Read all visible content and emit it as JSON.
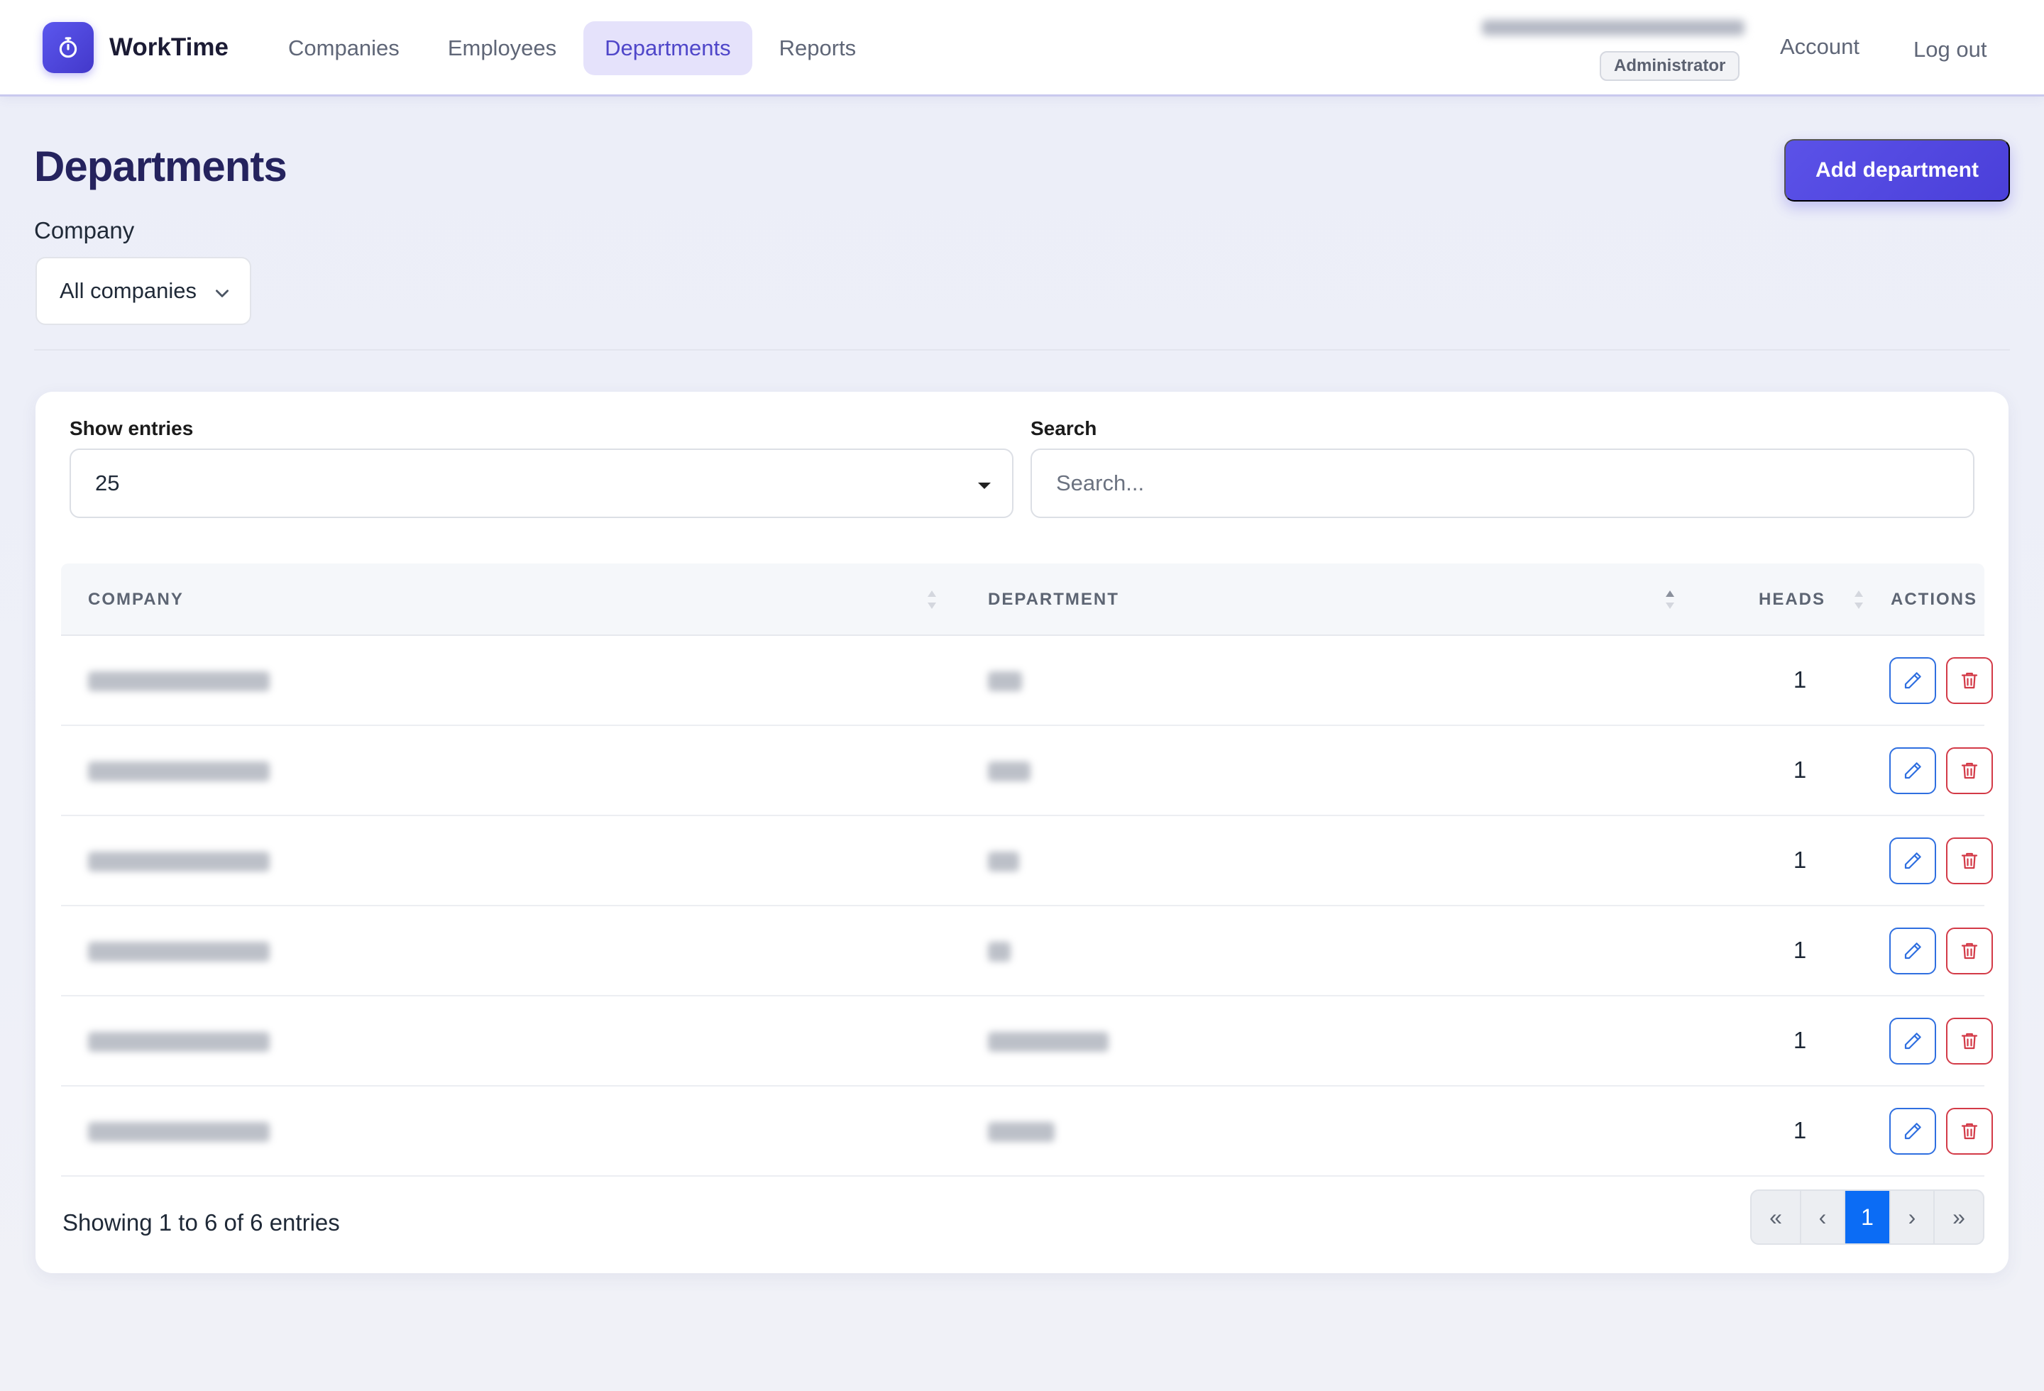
{
  "app": {
    "name": "WorkTime"
  },
  "nav": {
    "links": [
      {
        "label": "Companies"
      },
      {
        "label": "Employees"
      },
      {
        "label": "Departments"
      },
      {
        "label": "Reports"
      }
    ],
    "active_link": "Departments",
    "role_badge": "Administrator",
    "account_label": "Account",
    "logout_label": "Log out"
  },
  "page": {
    "title": "Departments",
    "add_button": "Add department",
    "company_filter_label": "Company",
    "company_filter_value": "All companies"
  },
  "table_controls": {
    "entries_label": "Show entries",
    "entries_value": "25",
    "search_label": "Search",
    "search_placeholder": "Search..."
  },
  "table": {
    "columns": [
      "COMPANY",
      "DEPARTMENT",
      "HEADS",
      "ACTIONS"
    ],
    "rows": [
      {
        "heads": "1"
      },
      {
        "heads": "1"
      },
      {
        "heads": "1"
      },
      {
        "heads": "1"
      },
      {
        "heads": "1"
      },
      {
        "heads": "1"
      }
    ]
  },
  "footer": {
    "info": "Showing 1 to 6 of 6 entries",
    "pagination": [
      "«",
      "‹",
      "1",
      "›",
      "»"
    ],
    "current_page": "1"
  },
  "colors": {
    "brand": "#4f46e5",
    "edit": "#2f6fe0",
    "delete": "#d33a47",
    "active_page": "#0b6cf5"
  }
}
